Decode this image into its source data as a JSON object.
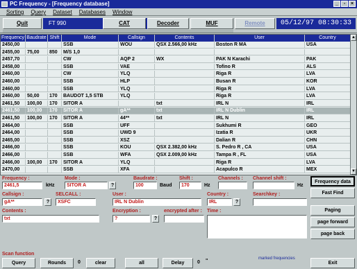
{
  "window": {
    "title": "PC Frequency - [Frequency database]",
    "win_min": "_",
    "win_max": "▫",
    "win_close": "×"
  },
  "menu": [
    "Sorting",
    "Query",
    "Dataset",
    "Databases",
    "Window"
  ],
  "toolbar": {
    "quit": "Quit",
    "mode_display": "FT 990",
    "cat": "CAT",
    "decoder": "Decoder",
    "muf": "MUF",
    "remote": "Remote",
    "datetime": "05/12/97 08:30:33"
  },
  "grid": {
    "columns": [
      "Frequency",
      "Baudrate",
      "Shift",
      "Mode",
      "Callsign",
      "Contents",
      "User",
      "Country"
    ],
    "rows": [
      [
        "2450,00",
        "",
        "",
        "SSB",
        "WOU",
        "QSX 2.566,00 kHz",
        "Boston R MA",
        "USA"
      ],
      [
        "2455,00",
        "75,00",
        "850",
        "M/S 1,0",
        "",
        "",
        "",
        ""
      ],
      [
        "2457,70",
        "",
        "",
        "CW",
        "AQP 2",
        "WX",
        "PAK N Karachi",
        "PAK"
      ],
      [
        "2458,00",
        "",
        "",
        "SSB",
        "VAE",
        "",
        "Tofino R",
        "ALS"
      ],
      [
        "2460,00",
        "",
        "",
        "CW",
        "YLQ",
        "",
        "Riga R",
        "LVA"
      ],
      [
        "2460,00",
        "",
        "",
        "SSB",
        "HLP",
        "",
        "Busan R",
        "KOR"
      ],
      [
        "2460,00",
        "",
        "",
        "SSB",
        "YLQ",
        "",
        "Riga R",
        "LVA"
      ],
      [
        "2460,00",
        "50,00",
        "170",
        "BAUDOT 1,5 STB",
        "YLQ",
        "",
        "Riga R",
        "LVA"
      ],
      [
        "2461,50",
        "100,00",
        "170",
        "SITOR A",
        "",
        "txt",
        "IRL N",
        "IRL"
      ],
      [
        "2461,50",
        "100,00",
        "170",
        "SITOR A",
        "gA**",
        "txt",
        "IRL N Dublin",
        "IRL"
      ],
      [
        "2461,50",
        "100,00",
        "170",
        "SITOR A",
        "44**",
        "txt",
        "IRL N",
        "IRL"
      ],
      [
        "2464,00",
        "",
        "",
        "SSB",
        "UFF",
        "",
        "Sukhumi R",
        "GEO"
      ],
      [
        "2464,00",
        "",
        "",
        "SSB",
        "UWD 9",
        "",
        "Izatia R",
        "UKR"
      ],
      [
        "2465,00",
        "",
        "",
        "SSB",
        "XSZ",
        "",
        "Dalian R",
        "CHN"
      ],
      [
        "2466,00",
        "",
        "",
        "SSB",
        "KOU",
        "QSX 2.382,00 kHz",
        "S. Pedro R , CA",
        "USA"
      ],
      [
        "2466,00",
        "",
        "",
        "SSB",
        "WFA",
        "QSX 2.009,00 kHz",
        "Tampa R , FL",
        "USA"
      ],
      [
        "2466,00",
        "100,00",
        "170",
        "SITOR A",
        "YLQ",
        "",
        "Riga R",
        "LVA"
      ],
      [
        "2470,00",
        "",
        "",
        "SSB",
        "XFA",
        "",
        "Acapulco R",
        "MEX"
      ]
    ],
    "selected_row": 9
  },
  "form": {
    "frequency_label": "Frequency :",
    "frequency_value": "2461,5",
    "frequency_unit": "kHz",
    "mode_label": "Mode :",
    "mode_value": "SITOR A",
    "baudrate_label": "Baudrate :",
    "baudrate_value": "100",
    "baudrate_unit": "Baud",
    "shift_label": "Shift :",
    "shift_value": "170",
    "shift_unit": "Hz",
    "channels_label": "Channels :",
    "channel_shift_label": "Channel shift :",
    "channel_shift_unit": "Hz",
    "callsign_label": "Callsign :",
    "callsign_value": "gA**",
    "selcall_label": "SELCALL :",
    "selcall_value": "XSFC",
    "user_label": "User :",
    "user_value": "IRL N Dublin",
    "country_label": "Country :",
    "country_value": "IRL",
    "searchkey_label": "Searchkey :",
    "contents_label": "Contents :",
    "contents_value": "txt",
    "encryption_label": "Encryption :",
    "encryption_value": "?",
    "encrypted_after_label": "encrypted after :",
    "time_label": "Time :",
    "q": "?",
    "scan_label": "Scan function",
    "marked_label": "marked frequencies"
  },
  "side_buttons": [
    "Frequency data",
    "Fast Find",
    "Paging",
    "page forward",
    "page back",
    "Exit"
  ],
  "bottom_buttons": {
    "query": "Query",
    "rounds": "Rounds",
    "rounds_count": "0",
    "clear": "clear",
    "all": "all",
    "delay": "Delay",
    "delay_count": "0",
    "delay_unit": "\""
  }
}
